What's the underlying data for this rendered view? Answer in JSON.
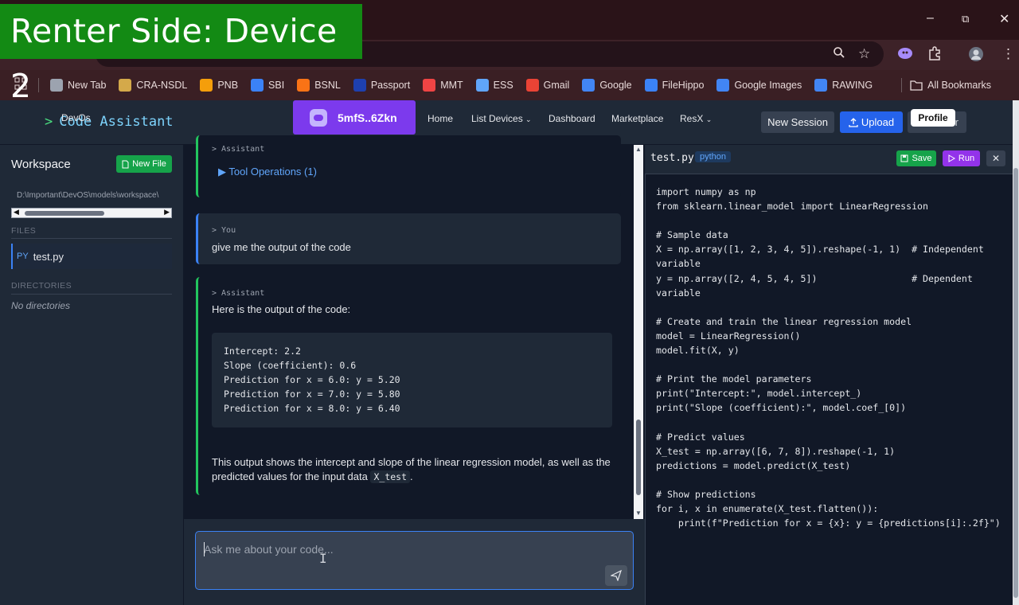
{
  "overlay": {
    "banner": "Renter Side: Device 2"
  },
  "browser": {
    "window_controls": {
      "minimize": "–",
      "maximize": "⧉",
      "close": "✕"
    },
    "bookmarks": [
      {
        "label": "New Tab",
        "color": "#9ca3af"
      },
      {
        "label": "CRA-NSDL",
        "color": "#d4a94a"
      },
      {
        "label": "PNB",
        "color": "#f59e0b"
      },
      {
        "label": "SBI",
        "color": "#3b82f6"
      },
      {
        "label": "BSNL",
        "color": "#f97316"
      },
      {
        "label": "Passport",
        "color": "#1e40af"
      },
      {
        "label": "MMT",
        "color": "#ef4444"
      },
      {
        "label": "ESS",
        "color": "#60a5fa"
      },
      {
        "label": "Gmail",
        "color": "#ea4335"
      },
      {
        "label": "Google",
        "color": "#4285f4"
      },
      {
        "label": "FileHippo",
        "color": "#3b82f6"
      },
      {
        "label": "Google Images",
        "color": "#4285f4"
      },
      {
        "label": "RAWING",
        "color": "#4285f4"
      }
    ],
    "all_bookmarks": "All Bookmarks"
  },
  "header": {
    "logo_prompt": ">",
    "logo_text": "Code Assistant",
    "logo_small": "DevOs",
    "wallet": "5mfS..6Zkn",
    "nav": {
      "home": "Home",
      "list_devices": "List Devices",
      "dashboard": "Dashboard",
      "marketplace": "Marketplace",
      "resx": "ResX"
    },
    "new_session": "New Session",
    "upload": "Upload",
    "profile_tail": "r",
    "profile_tooltip": "Profile"
  },
  "sidebar": {
    "title": "Workspace",
    "new_file": "New File",
    "path": "D:\\Important\\DevOS\\models\\workspace\\",
    "files_label": "FILES",
    "file": {
      "type": "PY",
      "name": "test.py"
    },
    "dirs_label": "DIRECTORIES",
    "no_dirs": "No directories"
  },
  "chat": {
    "m1_role": "> Assistant",
    "tool_ops": "▶ Tool Operations (1)",
    "m2_role": "> You",
    "m2_text": "give me the output of the code",
    "m3_role": "> Assistant",
    "m3_intro": "Here is the output of the code:",
    "output_lines": [
      "Intercept: 2.2",
      "Slope (coefficient): 0.6",
      "Prediction for x = 6.0: y = 5.20",
      "Prediction for x = 7.0: y = 5.80",
      "Prediction for x = 8.0: y = 6.40"
    ],
    "m3_outro_1": "This output shows the intercept and slope of the linear regression model, as well as the",
    "m3_outro_2": "predicted values for the input data",
    "m3_outro_code": "X_test",
    "m3_outro_end": ".",
    "input_placeholder": "Ask me about your code..."
  },
  "editor": {
    "filename": "test.py",
    "language": "python",
    "save": "Save",
    "run": "Run",
    "close": "✕",
    "code_lines": [
      "import numpy as np",
      "from sklearn.linear_model import LinearRegression",
      "",
      "# Sample data",
      "X = np.array([1, 2, 3, 4, 5]).reshape(-1, 1)  # Independent",
      "variable",
      "y = np.array([2, 4, 5, 4, 5])                 # Dependent",
      "variable",
      "",
      "# Create and train the linear regression model",
      "model = LinearRegression()",
      "model.fit(X, y)",
      "",
      "# Print the model parameters",
      "print(\"Intercept:\", model.intercept_)",
      "print(\"Slope (coefficient):\", model.coef_[0])",
      "",
      "# Predict values",
      "X_test = np.array([6, 7, 8]).reshape(-1, 1)",
      "predictions = model.predict(X_test)",
      "",
      "# Show predictions",
      "for i, x in enumerate(X_test.flatten()):",
      "    print(f\"Prediction for x = {x}: y = {predictions[i]:.2f}\")"
    ]
  }
}
